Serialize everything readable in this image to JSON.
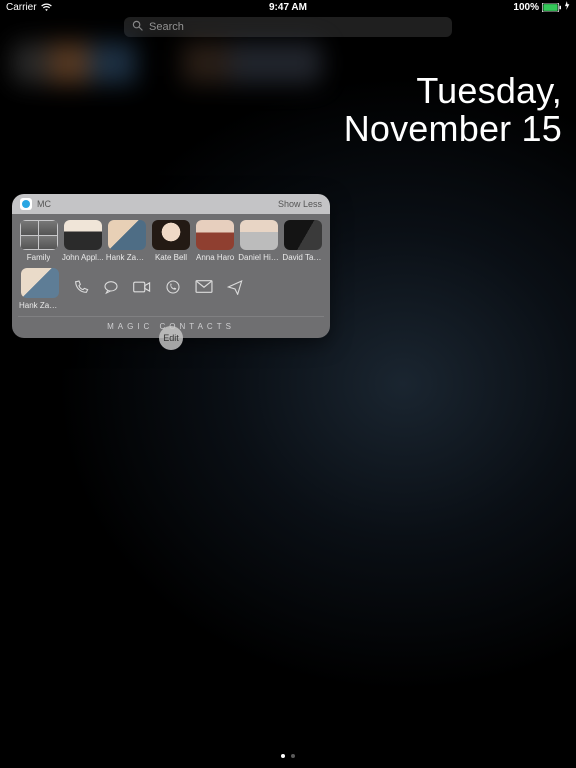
{
  "status_bar": {
    "carrier": "Carrier",
    "time": "9:47 AM",
    "battery_pct": "100%"
  },
  "search": {
    "placeholder": "Search"
  },
  "date": {
    "line1": "Tuesday,",
    "line2": "November 15"
  },
  "widget": {
    "app_name": "MC",
    "show_less": "Show Less",
    "footer": "MAGIC CONTACTS",
    "contacts": [
      {
        "name": "Family"
      },
      {
        "name": "John Appl..."
      },
      {
        "name": "Hank Zakr..."
      },
      {
        "name": "Kate Bell"
      },
      {
        "name": "Anna Haro"
      },
      {
        "name": "Daniel Hig..."
      },
      {
        "name": "David Taylor"
      }
    ],
    "selected_contact": {
      "name": "Hank Zakr..."
    },
    "action_icons": [
      "phone-icon",
      "message-icon",
      "video-icon",
      "whatsapp-icon",
      "email-icon",
      "share-icon"
    ]
  },
  "edit_label": "Edit"
}
